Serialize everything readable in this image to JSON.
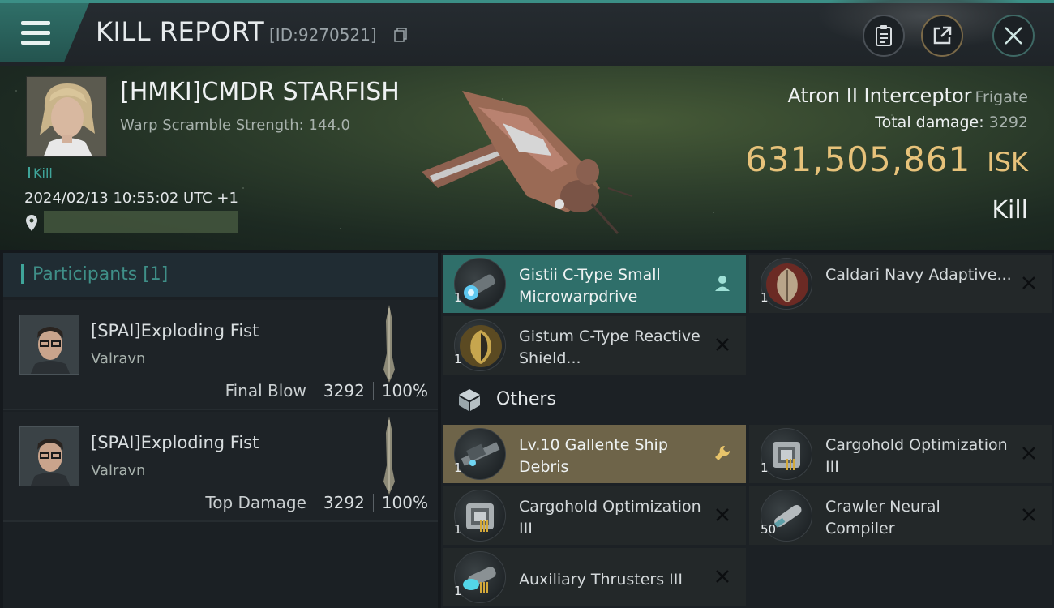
{
  "header": {
    "title": "KILL REPORT",
    "report_id": "[ID:9270521]",
    "icons": [
      "menu-icon",
      "copy-icon",
      "clipboard-icon",
      "share-icon",
      "close-icon"
    ]
  },
  "victim": {
    "name": "[HMKI]CMDR STARFISH",
    "warp_scramble": "Warp Scramble Strength: 144.0",
    "tag": "Kill",
    "datetime": "2024/02/13 10:55:02 UTC +1",
    "ship_name": "Atron II Interceptor",
    "ship_class": "Frigate",
    "total_damage_label": "Total damage:",
    "total_damage": "3292",
    "isk_value": "631,505,861",
    "isk_unit": "ISK",
    "result": "Kill"
  },
  "participants": {
    "title": "Participants [1]",
    "rows": [
      {
        "name": "[SPAI]Exploding Fist",
        "ship": "Valravn",
        "role": "Final Blow",
        "damage": "3292",
        "percent": "100%"
      },
      {
        "name": "[SPAI]Exploding Fist",
        "ship": "Valravn",
        "role": "Top Damage",
        "damage": "3292",
        "percent": "100%"
      }
    ]
  },
  "items": {
    "fitted": [
      {
        "name": "Gistii C-Type Small Microwarpdrive",
        "qty": "1",
        "status": "dropped-icon"
      },
      {
        "name": "Caldari Navy Adaptive...",
        "qty": "1",
        "status": "destroyed-icon"
      },
      {
        "name": "Gistum C-Type Reactive Shield...",
        "qty": "1",
        "status": "destroyed-icon"
      }
    ],
    "others_label": "Others",
    "others": [
      {
        "name": "Lv.10 Gallente Ship Debris",
        "qty": "1",
        "status": "wrench-icon"
      },
      {
        "name": "Cargohold Optimization III",
        "qty": "1",
        "status": "destroyed-icon"
      },
      {
        "name": "Cargohold Optimization III",
        "qty": "1",
        "status": "destroyed-icon"
      },
      {
        "name": "Crawler Neural Compiler",
        "qty": "50",
        "status": "destroyed-icon"
      },
      {
        "name": "Auxiliary Thrusters III",
        "qty": "1",
        "status": "destroyed-icon"
      }
    ]
  },
  "colors": {
    "accent_teal": "#3fa59a",
    "isk_gold": "#e7c27a",
    "dropped_highlight": "#2f6f6a",
    "special_highlight": "#6e6449"
  }
}
